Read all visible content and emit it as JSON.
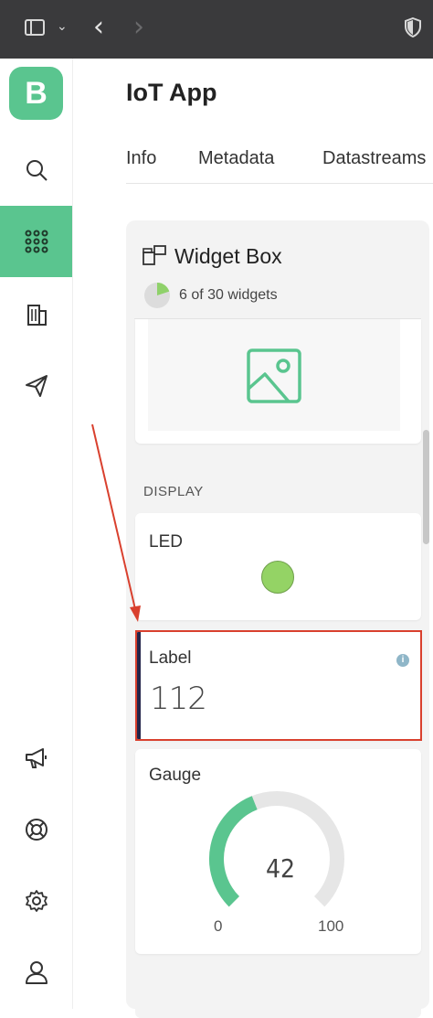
{
  "app": {
    "title": "IoT App",
    "logo_letter": "B"
  },
  "tabs": [
    {
      "label": "Info"
    },
    {
      "label": "Metadata"
    },
    {
      "label": "Datastreams"
    }
  ],
  "nav": {
    "items": [
      {
        "icon": "search-icon"
      },
      {
        "icon": "grid-icon",
        "active": true
      },
      {
        "icon": "building-icon"
      },
      {
        "icon": "paper-plane-icon"
      },
      {
        "icon": "megaphone-icon"
      },
      {
        "icon": "lifebuoy-icon"
      },
      {
        "icon": "gear-icon"
      },
      {
        "icon": "user-icon"
      }
    ]
  },
  "widget_box": {
    "title": "Widget Box",
    "count_text": "6 of 30 widgets",
    "usage_fraction": 0.2,
    "section_display": "DISPLAY",
    "led": {
      "title": "LED",
      "color": "#94d365"
    },
    "label": {
      "title": "Label",
      "value": "112",
      "info": "i"
    },
    "gauge": {
      "title": "Gauge",
      "value": "42",
      "min": "0",
      "max": "100",
      "fraction": 0.42,
      "color": "#5ac58f"
    }
  },
  "colors": {
    "brand": "#5ac58f",
    "annotation": "#d9402e"
  }
}
